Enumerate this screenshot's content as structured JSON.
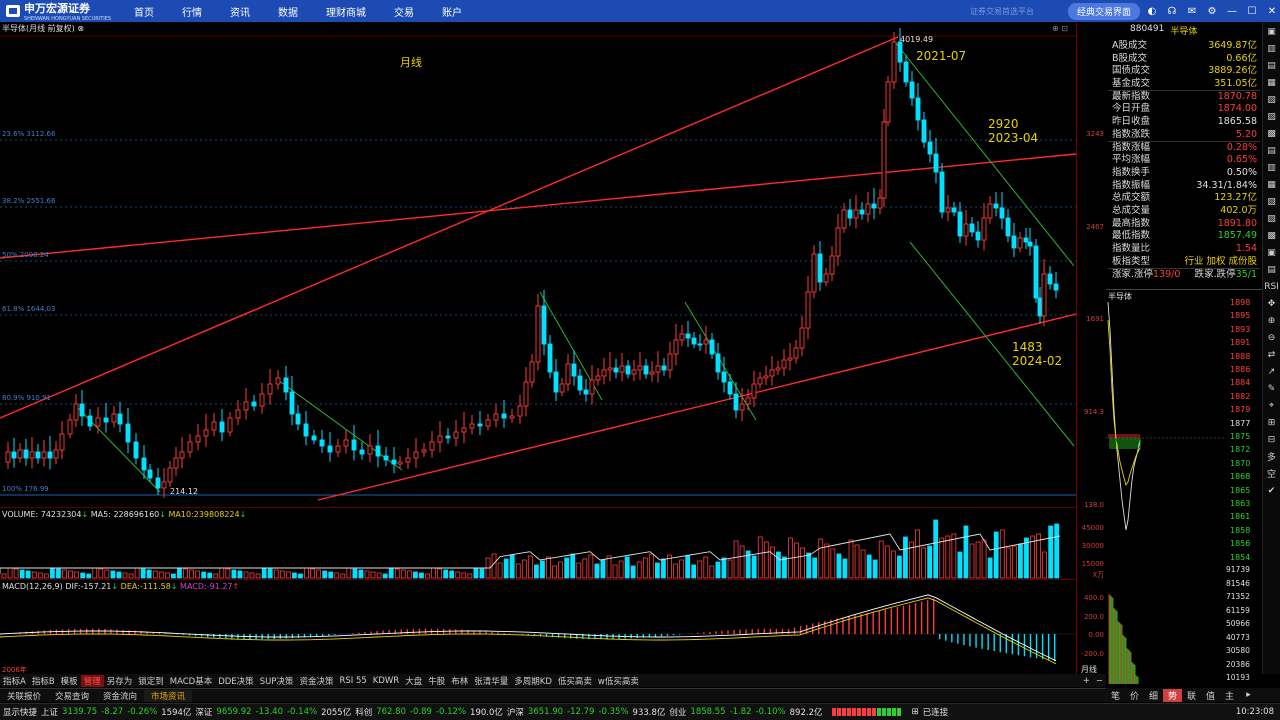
{
  "app": {
    "logo_text": "申万宏源证券",
    "logo_sub": "SHENWAN HONGYUAN SECURITIES",
    "menu": [
      "首页",
      "行情",
      "资讯",
      "数据",
      "理财商城",
      "交易",
      "账户"
    ],
    "slogan": "证券交易首选平台",
    "classic_label": "经典交易界面"
  },
  "chart_title": "半导体(月线 前复权)",
  "annotations": {
    "period": "月线",
    "peak_value": "4019.49",
    "low_value": "214.12",
    "p1": "2021-07",
    "p2a": "2920",
    "p2b": "2023-04",
    "p3a": "1483",
    "p3b": "2024-02"
  },
  "fib": [
    "23.6% 3112.66",
    "38.2% 2551.66",
    "50% 2098.24",
    "61.8% 1644.03",
    "80.9% 910.91",
    "100% 176.99"
  ],
  "price_axis": [
    "3243",
    "2467",
    "1691",
    "914.3",
    "138.0"
  ],
  "volume": {
    "label": "VOLUME:",
    "value": "74232304",
    "ma5_label": "MA5:",
    "ma5": "228696160",
    "ma10_label": "MA10:",
    "ma10": "239808224",
    "axis": [
      "45000",
      "30000",
      "15000"
    ],
    "unit": "X万"
  },
  "macd": {
    "label": "MACD(12,26,9)",
    "dif_label": "DIF:",
    "dif": "-157.21",
    "dea_label": "DEA:",
    "dea": "-111.58",
    "macd_label": "MACD:",
    "macd": "-91.27",
    "axis": [
      "400.0",
      "200.0",
      "0.00",
      "-200.0"
    ]
  },
  "date_axis_label": "2006年",
  "period_btn": "月线",
  "quote": {
    "code": "880491",
    "name": "半导体",
    "rows": [
      {
        "label": "A股成交",
        "value": "3649.87亿",
        "c": "yl"
      },
      {
        "label": "B股成交",
        "value": "0.66亿",
        "c": "yl"
      },
      {
        "label": "国债成交",
        "value": "3889.26亿",
        "c": "yl"
      },
      {
        "label": "基金成交",
        "value": "351.05亿",
        "c": "yl"
      },
      {
        "label": "最新指数",
        "value": "1870.78",
        "c": "up"
      },
      {
        "label": "今日开盘",
        "value": "1874.00",
        "c": "up"
      },
      {
        "label": "昨日收盘",
        "value": "1865.58",
        "c": "wh"
      },
      {
        "label": "指数涨跌",
        "value": "5.20",
        "c": "up"
      },
      {
        "label": "指数涨幅",
        "value": "0.28%",
        "c": "up"
      },
      {
        "label": "平均涨幅",
        "value": "0.65%",
        "c": "up"
      },
      {
        "label": "指数换手",
        "value": "0.50%",
        "c": "wh"
      },
      {
        "label": "指数振幅",
        "value": "34.31/1.84%",
        "c": "wh"
      },
      {
        "label": "总成交额",
        "value": "123.27亿",
        "c": "yl"
      },
      {
        "label": "总成交量",
        "value": "402.0万",
        "c": "yl"
      },
      {
        "label": "最高指数",
        "value": "1891.80",
        "c": "up"
      },
      {
        "label": "最低指数",
        "value": "1857.49",
        "c": "dn"
      },
      {
        "label": "指数量比",
        "value": "1.54",
        "c": "up"
      },
      {
        "label": "板指类型",
        "value": "行业 加权 成份股",
        "c": "yl"
      }
    ],
    "updown_label": "涨家.涨停",
    "updown": "139/0",
    "downs_label": "跌家.跌停",
    "downs": "35/1"
  },
  "intraday": {
    "title": "半导体",
    "price_axis": [
      "1898",
      "1895",
      "1893",
      "1891",
      "1888",
      "1886",
      "1884",
      "1882",
      "1879",
      "1877",
      "1875",
      "1872",
      "1870",
      "1868",
      "1865",
      "1863",
      "1861",
      "1858",
      "1856",
      "1854"
    ],
    "vol_axis": [
      "91739",
      "81546",
      "71352",
      "61159",
      "50966",
      "40773",
      "30580",
      "20386",
      "10193"
    ]
  },
  "tabs_row1": [
    "指标A",
    "指标B",
    "模板",
    "管理",
    "另存为",
    "锁定到",
    "MACD基本",
    "DDE决策",
    "SUP决策",
    "资金决策",
    "RSI 55",
    "KDWR",
    "大盘",
    "牛股",
    "布林",
    "张清华量",
    "多周期KD",
    "低买高卖",
    "w低买高卖"
  ],
  "tabs_row2": [
    "关联报价",
    "交易查询",
    "资金流向",
    "市场资讯"
  ],
  "side_tabs": [
    "笔",
    "价",
    "细",
    "势",
    "联",
    "值",
    "主"
  ],
  "status": {
    "app": "显示快捷",
    "items": [
      {
        "name": "上证",
        "price": "3139.75",
        "chg": "-8.27",
        "pct": "-0.26%",
        "vol": "1594亿"
      },
      {
        "name": "深证",
        "price": "9659.92",
        "chg": "-13.40",
        "pct": "-0.14%",
        "vol": "2055亿"
      },
      {
        "name": "科创",
        "price": "762.80",
        "chg": "-0.89",
        "pct": "-0.12%",
        "vol": "190.0亿"
      },
      {
        "name": "沪深",
        "price": "3651.90",
        "chg": "-12.79",
        "pct": "-0.35%",
        "vol": "933.8亿"
      },
      {
        "name": "创业",
        "price": "1858.55",
        "chg": "-1.82",
        "pct": "-0.10%",
        "vol": "892.2亿"
      }
    ],
    "conn": "已连接",
    "time": "10:23:08"
  },
  "icons": [
    "skin-icon",
    "service-icon",
    "mail-icon",
    "settings-icon",
    "minimize-icon",
    "maximize-icon",
    "close-icon"
  ],
  "colors": {
    "up": "#ff3c3c",
    "down": "#00e0ff",
    "channel": "#ff2a2a",
    "trend": "#2ab42a",
    "nav": "#1c4bb4"
  }
}
